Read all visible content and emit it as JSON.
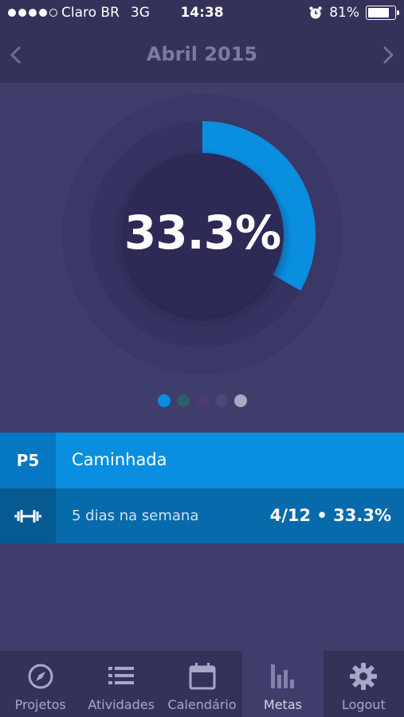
{
  "status_bar": {
    "carrier": "Claro BR",
    "network": "3G",
    "time": "14:38",
    "battery": "81%",
    "battery_level": 0.81,
    "signal_bars": 4,
    "signal_total": 5
  },
  "header": {
    "title": "Abril 2015"
  },
  "progress": {
    "percent_text": "33.3%",
    "value": 0.333,
    "colors": {
      "accent": "#0a8fe0",
      "ring_track": "#353361",
      "ring_inner": "#2e2c57"
    }
  },
  "pager": {
    "dots": [
      {
        "color": "#0a8fe0",
        "active": true
      },
      {
        "color": "#2f5d67"
      },
      {
        "color": "#4e3a70"
      },
      {
        "color": "#4a4878"
      },
      {
        "color": "#a9a7c3"
      }
    ]
  },
  "goal": {
    "code": "P5",
    "name": "Caminhada",
    "frequency": "5 dias na semana",
    "progress_text": "4/12 • 33.3%",
    "icon": "dumbbell-icon"
  },
  "tabs": [
    {
      "label": "Projetos",
      "icon": "compass-icon"
    },
    {
      "label": "Atividades",
      "icon": "list-icon"
    },
    {
      "label": "Calendário",
      "icon": "calendar-icon"
    },
    {
      "label": "Metas",
      "icon": "bar-chart-icon",
      "active": true
    },
    {
      "label": "Logout",
      "icon": "gear-icon"
    }
  ]
}
